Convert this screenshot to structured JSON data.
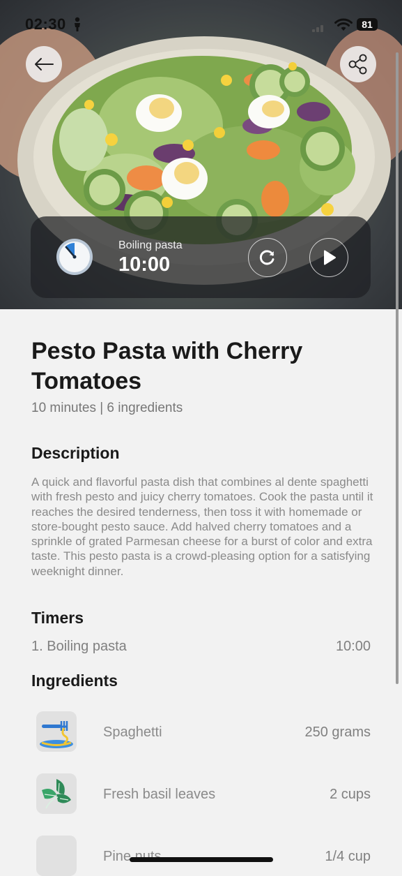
{
  "status_bar": {
    "time": "02:30",
    "battery": "81"
  },
  "timer_card": {
    "label": "Boiling pasta",
    "value": "10:00"
  },
  "recipe": {
    "title": "Pesto Pasta with Cherry Tomatoes",
    "meta": "10 minutes | 6 ingredients"
  },
  "description": {
    "heading": "Description",
    "text": "A quick and flavorful pasta dish that combines al dente spaghetti with fresh pesto and juicy cherry tomatoes. Cook the pasta until it reaches the desired tenderness, then toss it with homemade or store-bought pesto sauce. Add halved cherry tomatoes and a sprinkle of grated Parmesan cheese for a burst of color and extra taste. This pesto pasta is a crowd-pleasing option for a satisfying weeknight dinner."
  },
  "timers": {
    "heading": "Timers",
    "items": [
      {
        "name": "1. Boiling pasta",
        "duration": "10:00"
      }
    ]
  },
  "ingredients": {
    "heading": "Ingredients",
    "items": [
      {
        "name": "Spaghetti",
        "amount": "250 grams",
        "icon": "spaghetti-icon"
      },
      {
        "name": "Fresh basil leaves",
        "amount": "2 cups",
        "icon": "basil-icon"
      },
      {
        "name": "Pine nuts",
        "amount": "1/4 cup",
        "icon": "pine-nuts-placeholder"
      }
    ]
  }
}
